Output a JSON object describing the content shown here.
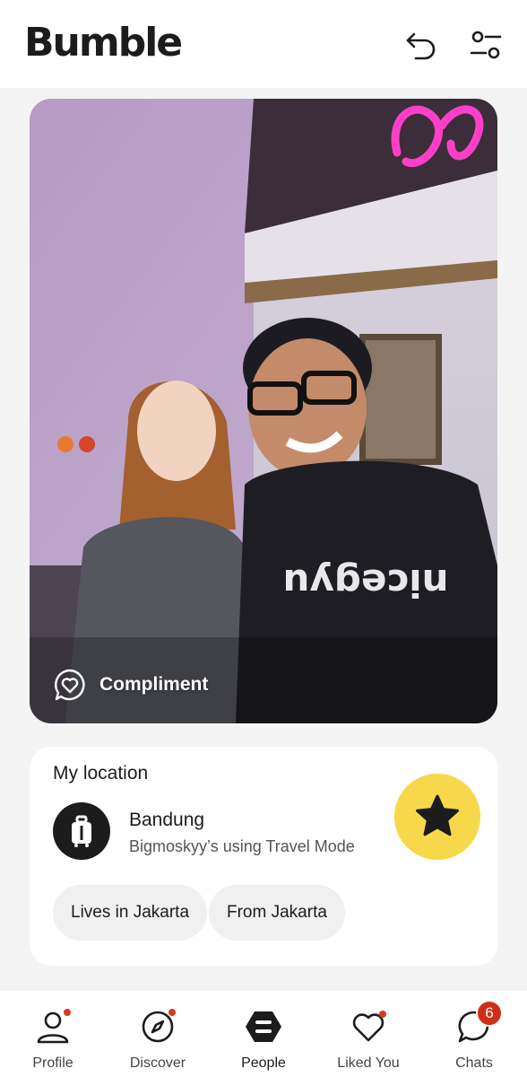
{
  "app": {
    "logo_text": "Bumble"
  },
  "header": {
    "undo_icon": "undo-arrow-icon",
    "filters_icon": "filter-sliders-icon"
  },
  "photo": {
    "compliment_label": "Compliment",
    "compliment_icon": "heart-speech-bubble-icon"
  },
  "location": {
    "title": "My location",
    "city": "Bandung",
    "subtitle": "Bigmoskyy’s using Travel Mode",
    "icon": "suitcase-icon",
    "chips": [
      "Lives in Jakarta",
      "From Jakarta"
    ]
  },
  "superswipe": {
    "icon": "star-icon",
    "color": "#f7d84a"
  },
  "nav": {
    "items": [
      {
        "label": "Profile",
        "icon": "profile-icon",
        "dot": true
      },
      {
        "label": "Discover",
        "icon": "compass-icon",
        "dot": true
      },
      {
        "label": "People",
        "icon": "people-icon",
        "active": true
      },
      {
        "label": "Liked You",
        "icon": "heart-icon",
        "dot": true
      },
      {
        "label": "Chats",
        "icon": "chat-bubble-icon",
        "badge": "6"
      }
    ]
  },
  "colors": {
    "accent": "#f7d84a",
    "notification": "#d93a22",
    "text": "#1c1c1c"
  }
}
